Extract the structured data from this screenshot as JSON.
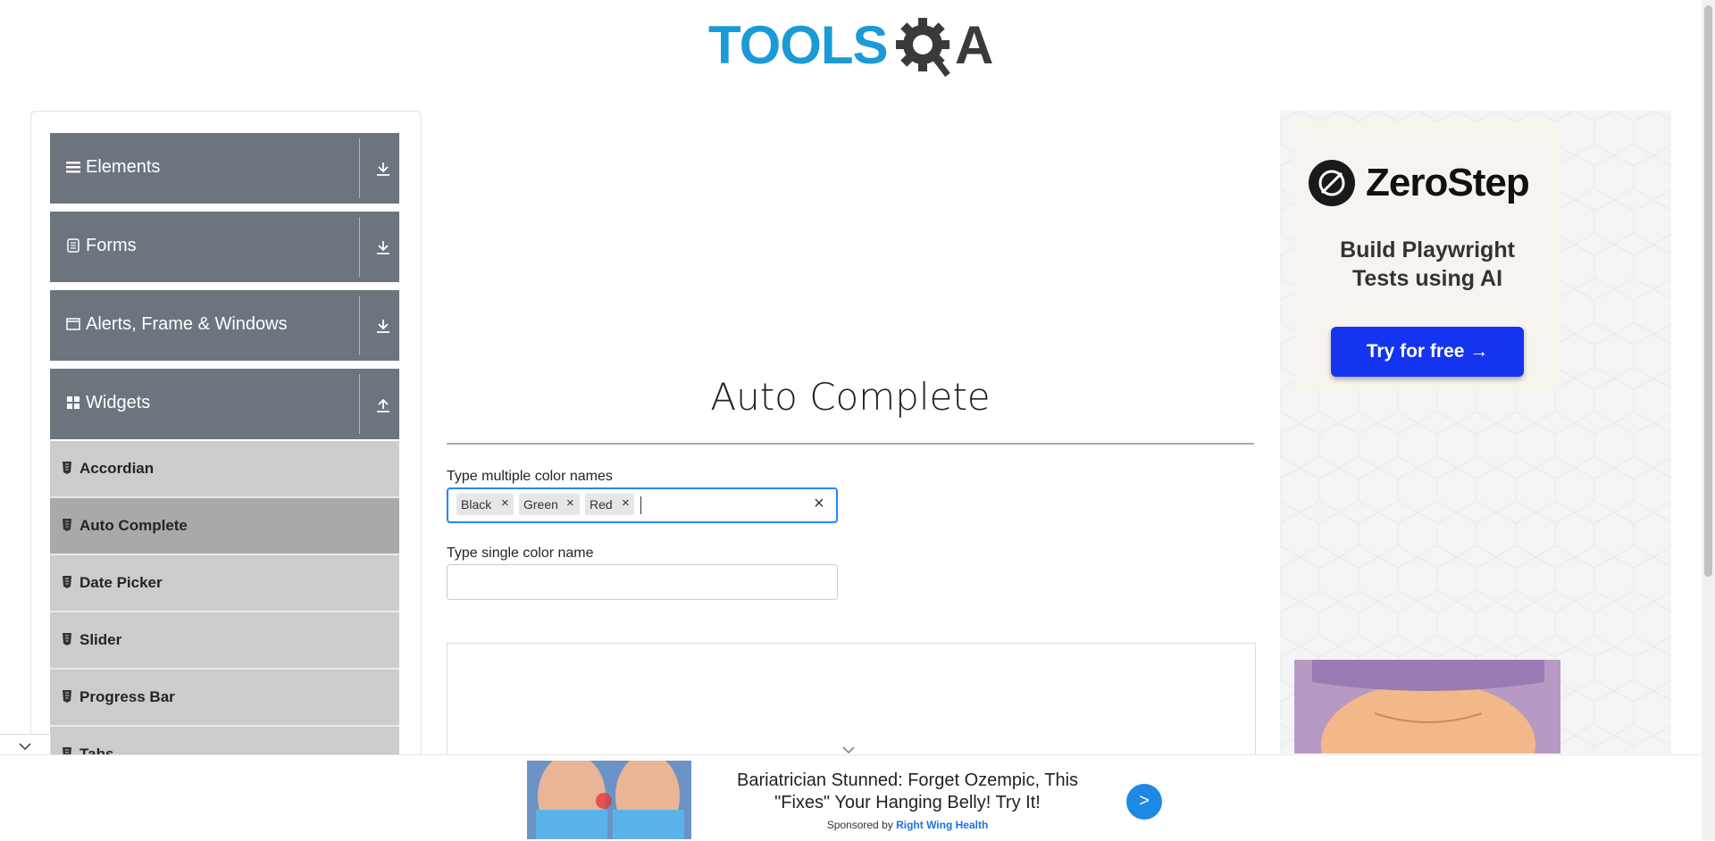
{
  "header": {
    "logo_text": "TOOLS",
    "logo_suffix": "A"
  },
  "sidebar": {
    "groups": [
      {
        "title": "Elements",
        "icon": "hamburger-icon",
        "arrow": "download-arrow-icon"
      },
      {
        "title": "Forms",
        "icon": "form-icon",
        "arrow": "download-arrow-icon"
      },
      {
        "title": "Alerts, Frame & Windows",
        "icon": "window-icon",
        "arrow": "download-arrow-icon"
      },
      {
        "title": "Widgets",
        "icon": "widgets-icon",
        "arrow": "upload-arrow-icon"
      }
    ],
    "widget_items": [
      {
        "label": "Accordian"
      },
      {
        "label": "Auto Complete",
        "active": true
      },
      {
        "label": "Date Picker"
      },
      {
        "label": "Slider"
      },
      {
        "label": "Progress Bar"
      },
      {
        "label": "Tabs"
      }
    ]
  },
  "main": {
    "title": "Auto Complete",
    "multi": {
      "label": "Type multiple color names",
      "chips": [
        "Black",
        "Green",
        "Red"
      ]
    },
    "single": {
      "label": "Type single color name",
      "value": ""
    }
  },
  "right_ad": {
    "brand": "ZeroStep",
    "tagline_line1": "Build Playwright",
    "tagline_line2": "Tests using AI",
    "cta": "Try for free →"
  },
  "bottom_ad": {
    "headline": "Bariatrician Stunned: Forget Ozempic, This \"Fixes\" Your Hanging Belly! Try It!",
    "sponsor_prefix": "Sponsored by",
    "sponsor_name": "Right Wing Health",
    "cta": ">"
  },
  "colors": {
    "menu_group_bg": "#6c757d",
    "menu_item_bg": "#cccccc",
    "menu_item_active_bg": "#a9a9a9",
    "focus_border": "#2684ff",
    "cta_blue": "#1434f0"
  }
}
